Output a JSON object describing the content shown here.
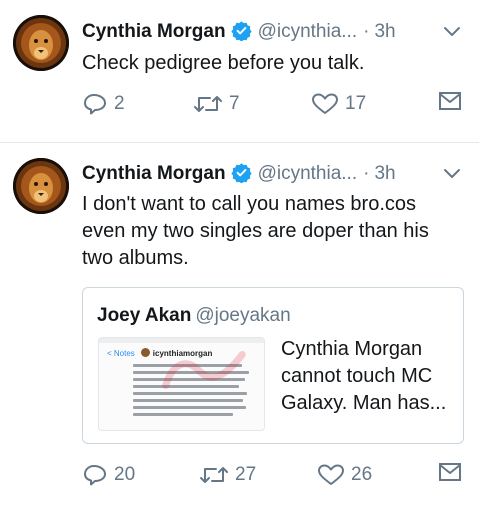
{
  "tweets": [
    {
      "display_name": "Cynthia Morgan",
      "handle": "@icynthia...",
      "dot": "·",
      "time": "3h",
      "text": "Check pedigree before you talk.",
      "replies": "2",
      "retweets": "7",
      "likes": "17"
    },
    {
      "display_name": "Cynthia Morgan",
      "handle": "@icynthia...",
      "dot": "·",
      "time": "3h",
      "text_lines": [
        "I don't want to call you names bro.cos",
        "even my two singles are doper than his",
        "two albums."
      ],
      "replies": "20",
      "retweets": "27",
      "likes": "26",
      "quoted": {
        "display_name": "Joey Akan",
        "handle": "@joeyakan",
        "text_lines": [
          "Cynthia Morgan",
          "cannot touch MC",
          "Galaxy. Man has..."
        ],
        "thumbnail": {
          "back_label": "< Notes",
          "username": "icynthiamorgan"
        }
      }
    }
  ],
  "colors": {
    "verified": "#1da1f2",
    "muted": "#657786",
    "text": "#14171a",
    "border": "#e1e8ed"
  },
  "icons": [
    "reply-icon",
    "retweet-icon",
    "like-icon",
    "direct-message-icon",
    "verified-badge-icon",
    "chevron-down-icon"
  ]
}
